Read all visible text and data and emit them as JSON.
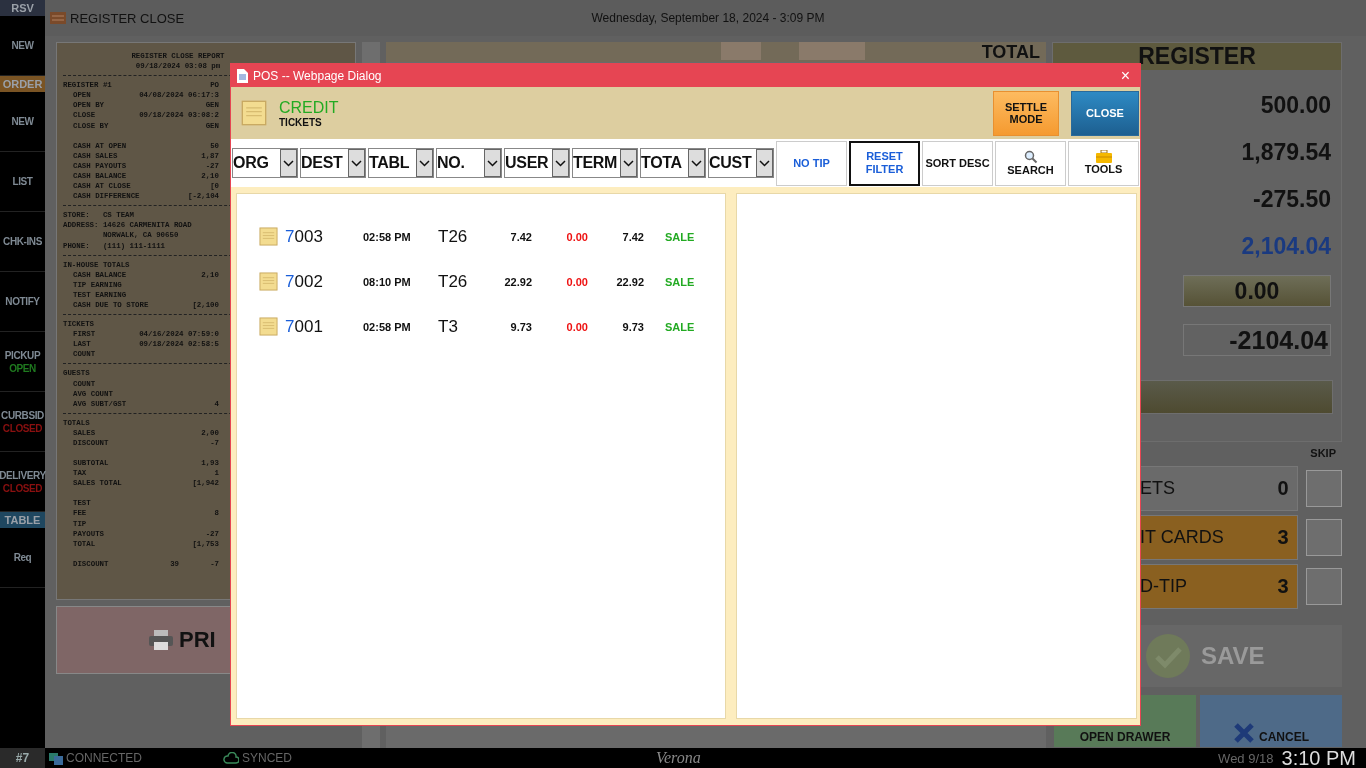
{
  "top_bar": {
    "title": "REGISTER CLOSE",
    "datetime": "Wednesday, September 18, 2024 - 3:09 PM"
  },
  "sidebar": [
    {
      "kind": "header",
      "label": "RSV",
      "color": "#2b3140"
    },
    {
      "kind": "button",
      "label": "NEW"
    },
    {
      "kind": "header",
      "label": "ORDER",
      "color": "#7a5424"
    },
    {
      "kind": "button",
      "label": "NEW"
    },
    {
      "kind": "button",
      "label": "LIST"
    },
    {
      "kind": "button",
      "label": "CHK-INS"
    },
    {
      "kind": "button",
      "label": "NOTIFY"
    },
    {
      "kind": "button",
      "label": "PICKUP",
      "status": "OPEN",
      "open": true
    },
    {
      "kind": "button",
      "label": "CURBSID",
      "status": "CLOSED",
      "open": false
    },
    {
      "kind": "button",
      "label": "DELIVERY",
      "status": "CLOSED",
      "open": false
    },
    {
      "kind": "header",
      "label": "TABLE",
      "color": "#1f4760"
    },
    {
      "kind": "button",
      "label": "Req"
    }
  ],
  "receipt": {
    "lines": [
      {
        "kind": "center",
        "text": "REGISTER CLOSE REPORT"
      },
      {
        "kind": "center",
        "text": "09/18/2024 03:08 pm"
      },
      {
        "kind": "rule"
      },
      {
        "kind": "line",
        "label": "REGISTER #1",
        "value": "PO"
      },
      {
        "kind": "item",
        "label": "OPEN",
        "value": "04/08/2024 06:17:3"
      },
      {
        "kind": "item",
        "label": "OPEN BY",
        "value": "GEN"
      },
      {
        "kind": "item",
        "label": "CLOSE",
        "value": "09/18/2024 03:08:2"
      },
      {
        "kind": "item",
        "label": "CLOSE BY",
        "value": "GEN"
      },
      {
        "kind": "blank"
      },
      {
        "kind": "item",
        "label": "CASH AT OPEN",
        "value": "50"
      },
      {
        "kind": "item",
        "label": "CASH SALES",
        "value": "1,87"
      },
      {
        "kind": "item",
        "label": "CASH PAYOUTS",
        "value": "-27"
      },
      {
        "kind": "item",
        "label": "CASH BALANCE",
        "value": "2,10"
      },
      {
        "kind": "item",
        "label": "CASH AT CLOSE",
        "value": "[0"
      },
      {
        "kind": "item",
        "label": "CASH DIFFERENCE",
        "value": "[-2,104"
      },
      {
        "kind": "rule"
      },
      {
        "kind": "line",
        "label": "STORE:   CS TEAM"
      },
      {
        "kind": "line",
        "label": "ADDRESS: 14626 CARMENITA ROAD"
      },
      {
        "kind": "line",
        "label": "         NORWALK, CA 90650"
      },
      {
        "kind": "line",
        "label": "PHONE:   (111) 111-1111"
      },
      {
        "kind": "rule"
      },
      {
        "kind": "line",
        "label": "IN-HOUSE TOTALS"
      },
      {
        "kind": "item",
        "label": "CASH BALANCE",
        "value": "2,10"
      },
      {
        "kind": "item",
        "label": "TIP EARNING"
      },
      {
        "kind": "item",
        "label": "TEST EARNING"
      },
      {
        "kind": "item",
        "label": "CASH DUE TO STORE",
        "value": "[2,100"
      },
      {
        "kind": "rule"
      },
      {
        "kind": "line",
        "label": "TICKETS"
      },
      {
        "kind": "item",
        "label": "FIRST",
        "value": "04/16/2024 07:59:0"
      },
      {
        "kind": "item",
        "label": "LAST",
        "value": "09/18/2024 02:58:5"
      },
      {
        "kind": "item",
        "label": "COUNT"
      },
      {
        "kind": "rule"
      },
      {
        "kind": "line",
        "label": "GUESTS"
      },
      {
        "kind": "item",
        "label": "COUNT"
      },
      {
        "kind": "item",
        "label": "AVG COUNT"
      },
      {
        "kind": "item",
        "label": "AVG SUBT/GST",
        "value": "4"
      },
      {
        "kind": "rule"
      },
      {
        "kind": "line",
        "label": "TOTALS"
      },
      {
        "kind": "item",
        "label": "SALES",
        "value": "2,00"
      },
      {
        "kind": "item",
        "label": "DISCOUNT",
        "value": "-7"
      },
      {
        "kind": "blank"
      },
      {
        "kind": "item",
        "label": "SUBTOTAL",
        "value": "1,93"
      },
      {
        "kind": "item",
        "label": "TAX",
        "value": "1"
      },
      {
        "kind": "item",
        "label": "SALES TOTAL",
        "value": "[1,942"
      },
      {
        "kind": "blank"
      },
      {
        "kind": "item",
        "label": "TEST"
      },
      {
        "kind": "item",
        "label": "FEE",
        "value": "8"
      },
      {
        "kind": "item",
        "label": "TIP"
      },
      {
        "kind": "item",
        "label": "PAYOUTS",
        "value": "-27"
      },
      {
        "kind": "item",
        "label": "TOTAL",
        "value": "[1,753"
      },
      {
        "kind": "blank"
      },
      {
        "kind": "item",
        "label": "DISCOUNT",
        "middle": "39",
        "value": "-7"
      }
    ]
  },
  "print_button": {
    "label": "PRI"
  },
  "middle_panel": {
    "title": "TOTAL"
  },
  "register": {
    "title": "REGISTER",
    "values": [
      {
        "kind": "plain",
        "text": "500.00"
      },
      {
        "kind": "plain",
        "text": "1,879.54"
      },
      {
        "kind": "plain",
        "text": "-275.50"
      },
      {
        "kind": "highlight",
        "text": "2,104.04"
      },
      {
        "kind": "input",
        "text": "0.00"
      },
      {
        "kind": "boxed",
        "text": "-2104.04"
      }
    ]
  },
  "skip_label": "SKIP",
  "tallies": [
    {
      "kind": "plain",
      "label": "ETS",
      "count": "0",
      "checked": false
    },
    {
      "kind": "alert",
      "label": "IT CARDS",
      "count": "3",
      "checked": false
    },
    {
      "kind": "alert",
      "label": "D-TIP",
      "count": "3",
      "checked": false
    }
  ],
  "save_button": {
    "label": "SAVE",
    "disabled": true
  },
  "action_buttons": [
    {
      "kind": "drawer",
      "label": "OPEN DRAWER"
    },
    {
      "kind": "cancel",
      "label": "CANCEL"
    }
  ],
  "dialog": {
    "title": "POS -- Webpage Dialog",
    "close_symbol": "×",
    "heading": "CREDIT",
    "subheading": "TICKETS",
    "header_buttons": [
      {
        "kind": "orange",
        "label": "SETTLE MODE"
      },
      {
        "kind": "blue",
        "label": "CLOSE"
      }
    ],
    "filters": [
      "ORG",
      "DEST",
      "TABL",
      "NO.",
      "USER",
      "TERM",
      "TOTA",
      "CUST"
    ],
    "tools": [
      {
        "kind": "link",
        "label": "NO TIP",
        "selected": false
      },
      {
        "kind": "link",
        "label": "RESET FILTER",
        "selected": true
      },
      {
        "kind": "text",
        "label": "SORT DESC",
        "selected": false
      },
      {
        "kind": "search",
        "label": "SEARCH",
        "selected": false
      },
      {
        "kind": "tools",
        "label": "TOOLS",
        "selected": false
      }
    ],
    "tickets": [
      {
        "number": "7003",
        "time": "02:58 PM",
        "table": "T26",
        "amount": "7.42",
        "tip": "0.00",
        "total": "7.42",
        "status": "SALE"
      },
      {
        "number": "7002",
        "time": "08:10 PM",
        "table": "T26",
        "amount": "22.92",
        "tip": "0.00",
        "total": "22.92",
        "status": "SALE"
      },
      {
        "number": "7001",
        "time": "02:58 PM",
        "table": "T3",
        "amount": "9.73",
        "tip": "0.00",
        "total": "9.73",
        "status": "SALE"
      }
    ]
  },
  "status_bar": {
    "station": "#7",
    "connection": "CONNECTED",
    "sync": "SYNCED",
    "brand": "Verona",
    "date": "Wed 9/18",
    "time": "3:10 PM"
  }
}
